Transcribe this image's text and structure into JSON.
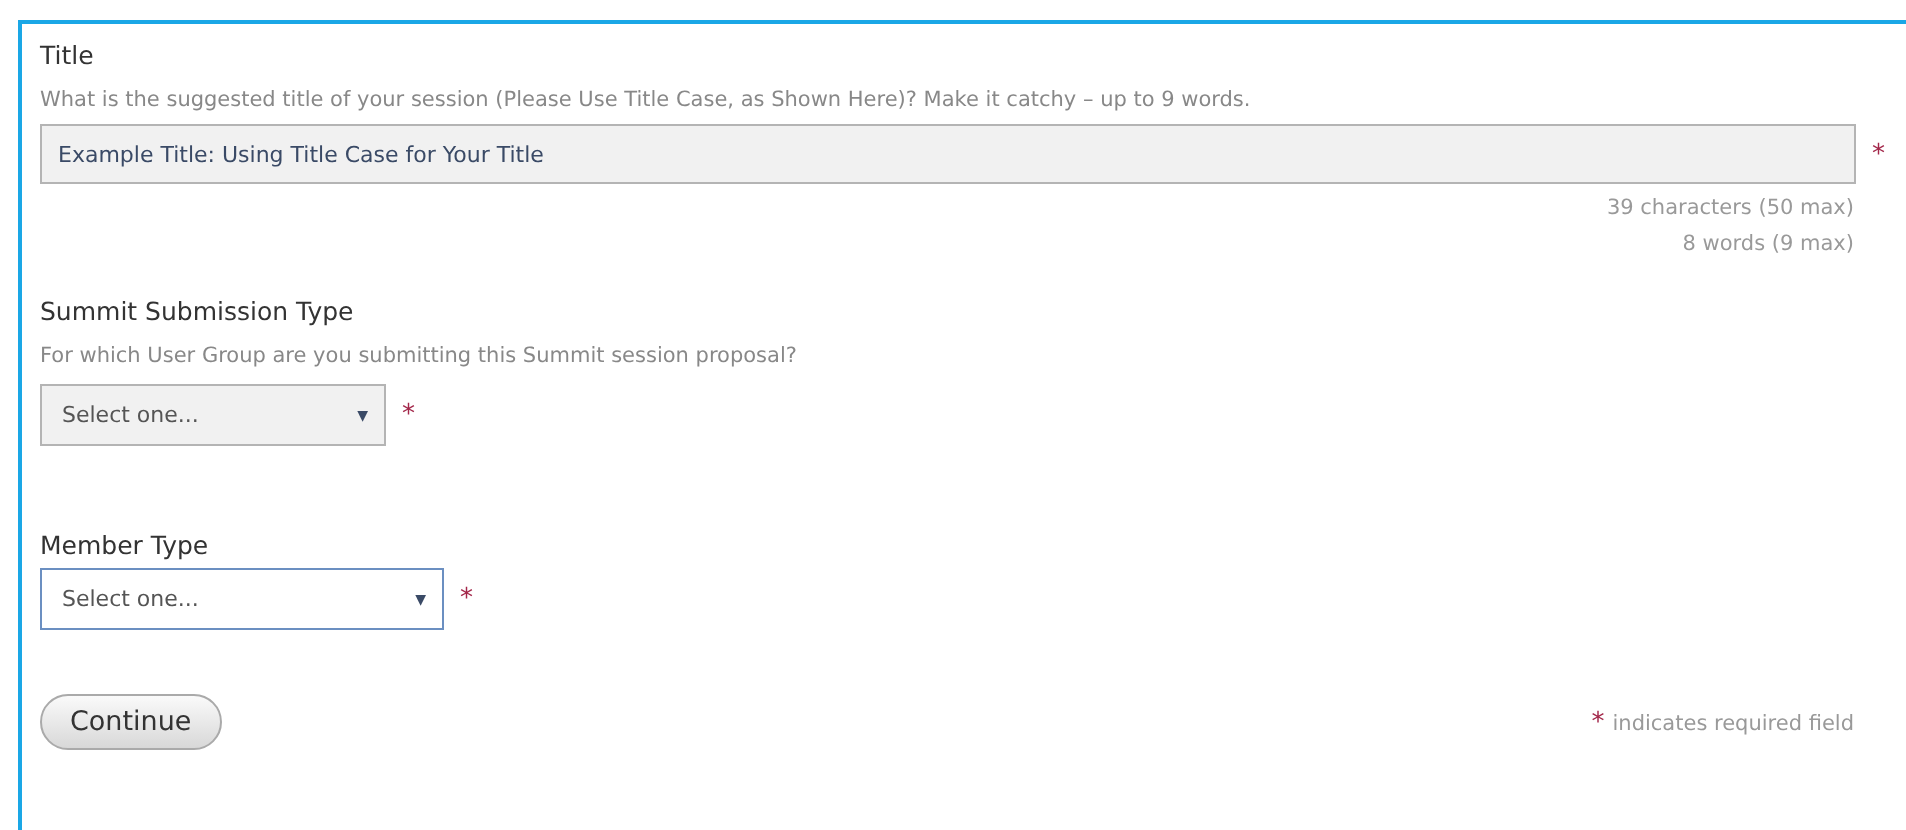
{
  "title_field": {
    "label": "Title",
    "hint": "What is the suggested title of your session (Please Use Title Case, as Shown Here)? Make it catchy – up to 9 words.",
    "value": "Example Title: Using Title Case for Your Title",
    "required_mark": "*",
    "counters": [
      "39 characters (50 max)",
      "8 words (9 max)"
    ]
  },
  "selects": [
    {
      "label": "Summit Submission Type",
      "hint": "For which User Group are you submitting this Summit session proposal?",
      "value": "Select one...",
      "caret": "▼",
      "required_mark": "*",
      "focused": false
    },
    {
      "label": "Member Type",
      "value": "Select one...",
      "caret": "▼",
      "required_mark": "*",
      "focused": true
    }
  ],
  "continue_button": "Continue",
  "legend": {
    "mark": "*",
    "text": "indicates required field"
  }
}
